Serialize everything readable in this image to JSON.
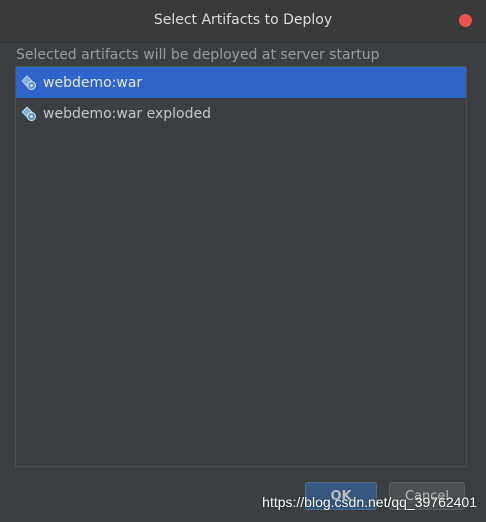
{
  "dialog": {
    "title": "Select Artifacts to Deploy",
    "description": "Selected artifacts will be deployed at server startup"
  },
  "artifacts": [
    {
      "label": "webdemo:war",
      "selected": true,
      "icon": "artifact-icon"
    },
    {
      "label": "webdemo:war exploded",
      "selected": false,
      "icon": "artifact-icon"
    }
  ],
  "buttons": {
    "ok": "OK",
    "cancel": "Cancel"
  },
  "watermark": "https://blog.csdn.net/qq_39762401",
  "colors": {
    "selection": "#2f65ca",
    "close": "#e9544f",
    "ok_button": "#365880"
  }
}
